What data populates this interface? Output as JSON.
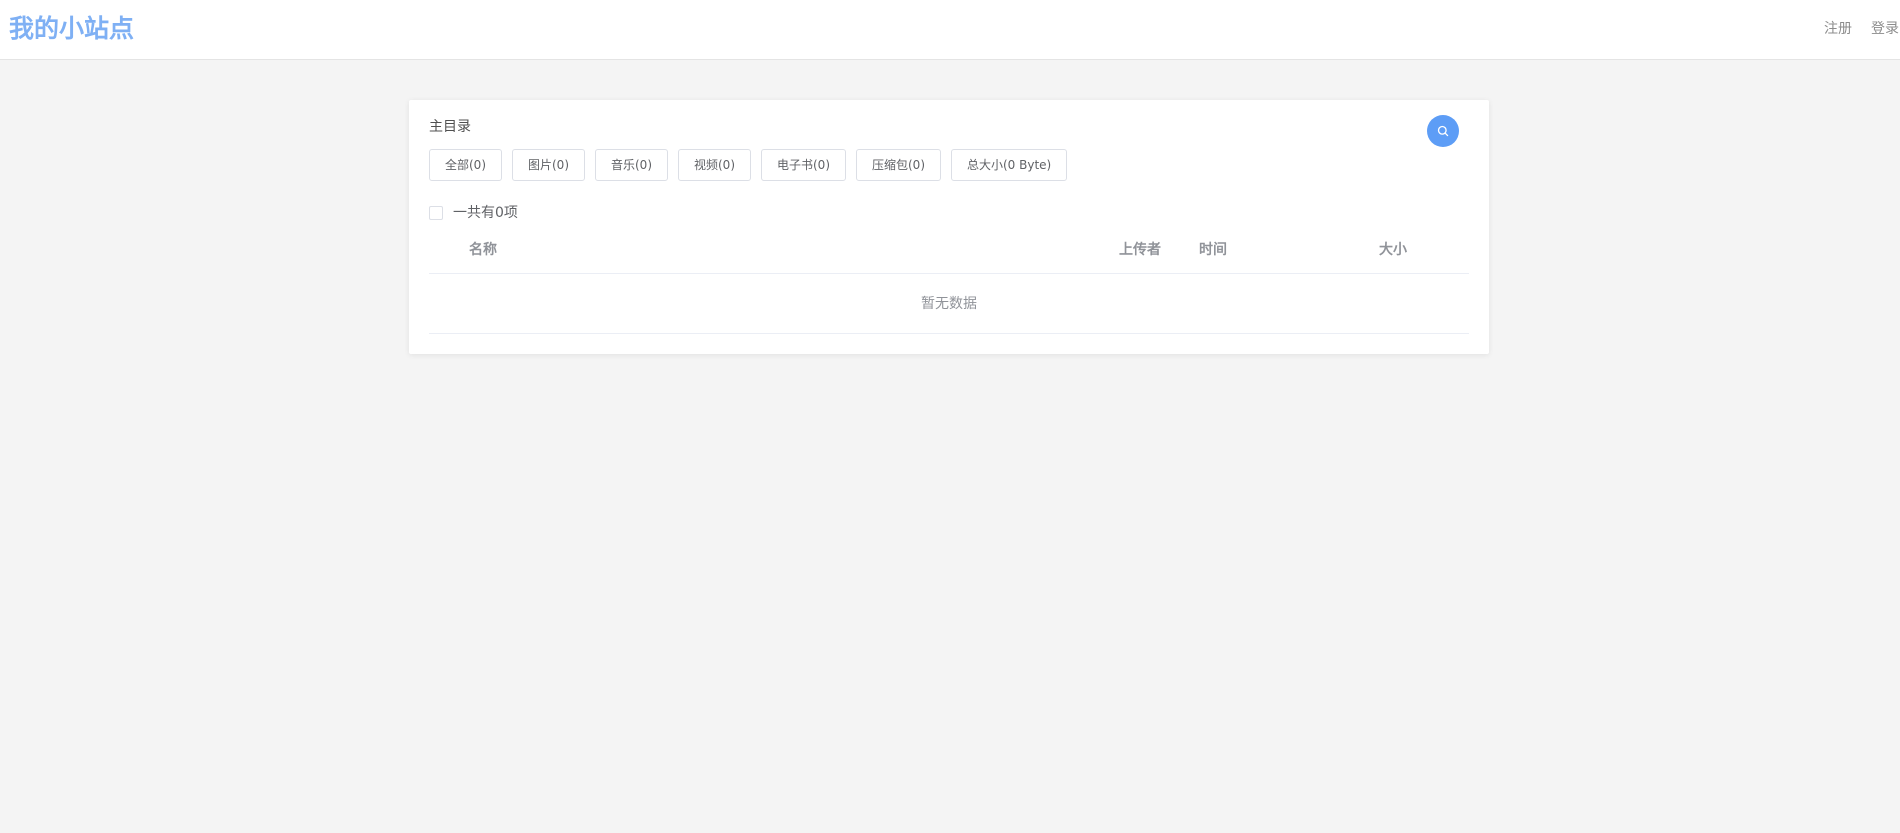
{
  "header": {
    "brand": "我的小站点",
    "nav": {
      "register": "注册",
      "login": "登录"
    }
  },
  "directory": {
    "title": "主目录",
    "search_icon": "search-icon",
    "filters": [
      "全部(0)",
      "图片(0)",
      "音乐(0)",
      "视频(0)",
      "电子书(0)",
      "压缩包(0)",
      "总大小(0 Byte)"
    ],
    "count_label": "一共有0项",
    "columns": {
      "name": "名称",
      "uploader": "上传者",
      "time": "时间",
      "size": "大小"
    },
    "empty_text": "暂无数据"
  },
  "colors": {
    "brand": "#7fb0f4",
    "accent": "#5d9df6",
    "background": "#f4f4f4"
  }
}
